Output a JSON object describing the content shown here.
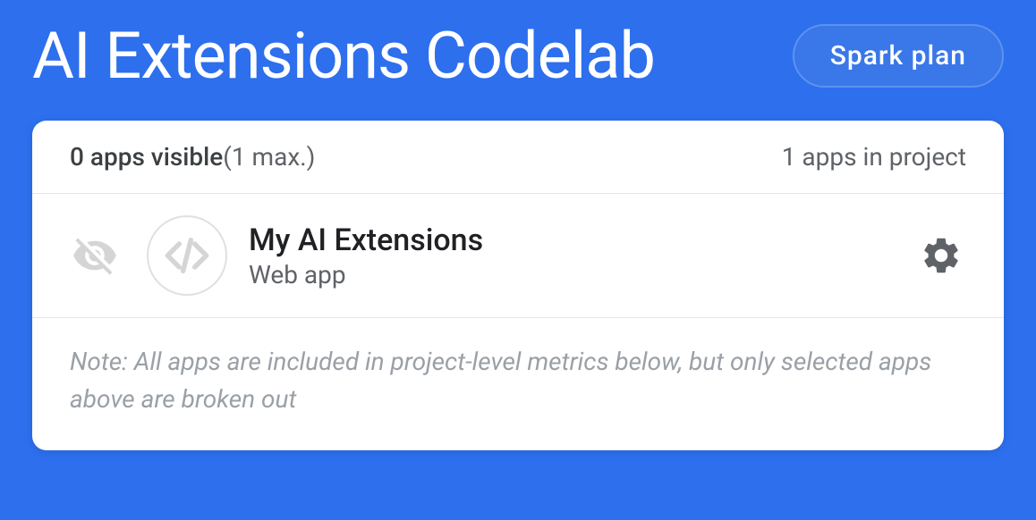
{
  "header": {
    "project_title": "AI Extensions Codelab",
    "plan_label": "Spark plan"
  },
  "card": {
    "apps_visible_count": "0 apps visible",
    "apps_visible_max": "(1 max.)",
    "apps_in_project": "1 apps in project",
    "app": {
      "name": "My AI Extensions",
      "type": "Web app"
    },
    "note": "Note: All apps are included in project-level metrics below, but only selected apps above are broken out"
  },
  "colors": {
    "background": "#2d6fed",
    "card_bg": "#ffffff",
    "text_primary": "#202124",
    "text_secondary": "#5f6368",
    "text_muted": "#9aa0a6",
    "icon_muted": "#d5d5d5",
    "gear": "#5f6368"
  }
}
